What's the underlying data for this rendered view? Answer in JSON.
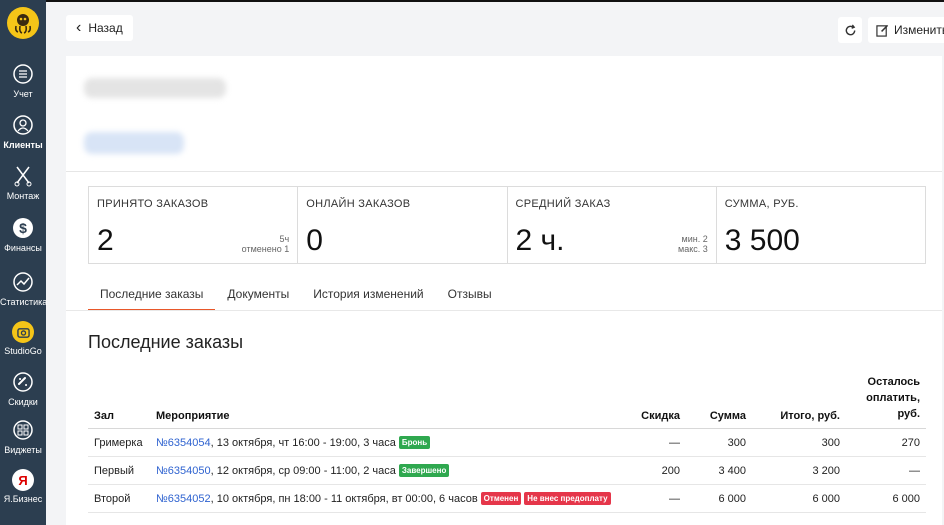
{
  "sidebar": {
    "items": [
      {
        "label": "Учет",
        "icon": "ledger-icon"
      },
      {
        "label": "Клиенты",
        "icon": "clients-icon"
      },
      {
        "label": "Монтаж",
        "icon": "scissors-icon"
      },
      {
        "label": "Финансы",
        "icon": "dollar-icon"
      },
      {
        "label": "Статистика",
        "icon": "chart-icon"
      },
      {
        "label": "StudioGo",
        "icon": "camera-icon"
      },
      {
        "label": "Скидки",
        "icon": "discount-tag-icon"
      },
      {
        "label": "Виджеты",
        "icon": "widgets-icon"
      },
      {
        "label": "Я.Бизнес",
        "icon": "yandex-icon"
      }
    ],
    "ya_glyph": "Я"
  },
  "topbar": {
    "back_label": "Назад",
    "back_icon": "‹",
    "edit_label": "Изменить"
  },
  "stats": [
    {
      "title": "ПРИНЯТО ЗАКАЗОВ",
      "value": "2",
      "sub1": "5ч",
      "sub2": "отменено 1"
    },
    {
      "title": "ОНЛАЙН ЗАКАЗОВ",
      "value": "0",
      "sub1": "",
      "sub2": ""
    },
    {
      "title": "СРЕДНИЙ ЗАКАЗ",
      "value": "2 ч.",
      "sub1": "мин. 2",
      "sub2": "макс. 3"
    },
    {
      "title": "СУММА, РУБ.",
      "value": "3 500",
      "sub1": "",
      "sub2": ""
    }
  ],
  "tabs": [
    "Последние заказы",
    "Документы",
    "История изменений",
    "Отзывы"
  ],
  "section_title": "Последние заказы",
  "table": {
    "headers": {
      "hall": "Зал",
      "event": "Мероприятие",
      "discount": "Скидка",
      "sum": "Сумма",
      "total": "Итого, руб.",
      "remaining": "Осталось оплатить, руб."
    },
    "rows": [
      {
        "hall": "Гримерка",
        "order": "№6354054",
        "details": ", 13 октября, чт 16:00 - 19:00, 3 часа",
        "badge1": "Бронь",
        "badge2": "",
        "discount": "—",
        "sum": "300",
        "total": "300",
        "remaining": "270"
      },
      {
        "hall": "Первый",
        "order": "№6354050",
        "details": ", 12 октября, ср 09:00 - 11:00, 2 часа",
        "badge1": "Завершено",
        "badge2": "",
        "discount": "200",
        "sum": "3 400",
        "total": "3 200",
        "remaining": "—"
      },
      {
        "hall": "Второй",
        "order": "№6354052",
        "details": ", 10 октября, пн 18:00 - 11 октября, вт 00:00, 6 часов",
        "badge1": "Отменен",
        "badge2": "Не внес предоплату",
        "discount": "—",
        "sum": "6 000",
        "total": "6 000",
        "remaining": "6 000"
      }
    ]
  },
  "colors": {
    "sidebar_bg": "#2c3e50",
    "accent": "#e8572a",
    "brand_yellow": "#f5c518",
    "link": "#2f63d0",
    "badge_green": "#2fa84f",
    "badge_red": "#e5364a"
  }
}
